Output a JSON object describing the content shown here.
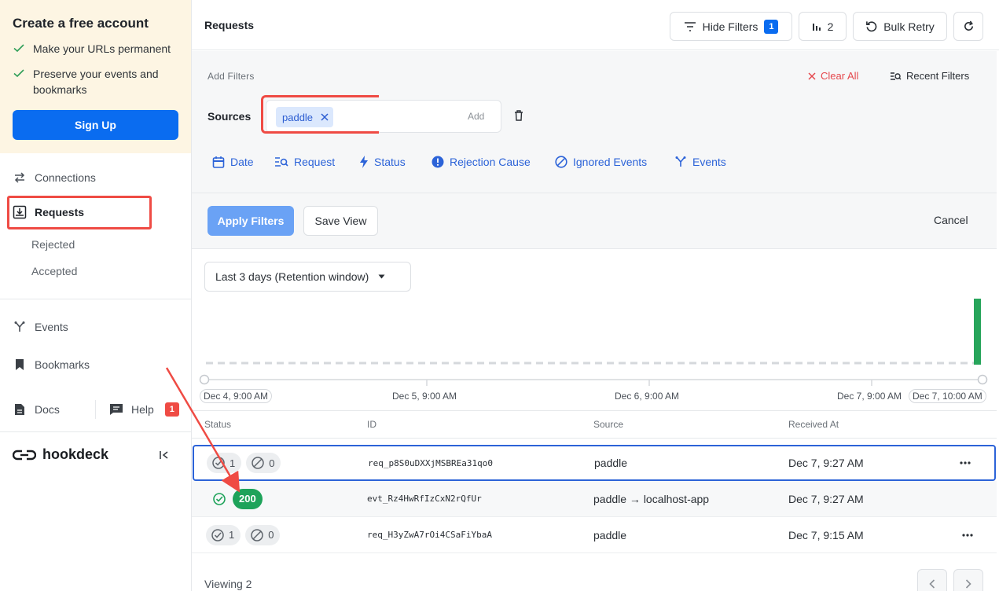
{
  "promo": {
    "title": "Create a free account",
    "bullets": [
      "Make your URLs permanent",
      "Preserve your events and bookmarks"
    ],
    "signup_label": "Sign Up"
  },
  "sidebar": {
    "connections": "Connections",
    "requests": "Requests",
    "rejected": "Rejected",
    "accepted": "Accepted",
    "events": "Events",
    "bookmarks": "Bookmarks",
    "docs": "Docs",
    "help": "Help",
    "help_count": "1",
    "brand": "hookdeck"
  },
  "header": {
    "title": "Requests",
    "hide_filters": "Hide Filters",
    "filter_count": "1",
    "chart_count": "2",
    "bulk_retry": "Bulk Retry"
  },
  "filters": {
    "add_filters": "Add Filters",
    "clear_all": "Clear All",
    "recent_filters": "Recent Filters",
    "sources_label": "Sources",
    "source_chip": "paddle",
    "add": "Add",
    "types": [
      "Date",
      "Request",
      "Status",
      "Rejection Cause",
      "Ignored Events",
      "Events"
    ],
    "apply": "Apply Filters",
    "save_view": "Save View",
    "cancel": "Cancel"
  },
  "chart": {
    "range": "Last 3 days (Retention window)",
    "ticks": [
      "Dec 4, 9:00 AM",
      "Dec 5, 9:00 AM",
      "Dec 6, 9:00 AM",
      "Dec 7, 9:00 AM",
      "Dec 7, 10:00 AM"
    ]
  },
  "chart_data": {
    "type": "bar",
    "x": [
      "Dec 4, 9:00 AM",
      "Dec 5, 9:00 AM",
      "Dec 6, 9:00 AM",
      "Dec 7, 9:00 AM",
      "Dec 7, 10:00 AM"
    ],
    "values": [
      0,
      0,
      0,
      2,
      0
    ],
    "bar_color": "#27a55b",
    "title": "",
    "xlabel": "",
    "ylabel": ""
  },
  "table": {
    "headers": [
      "Status",
      "ID",
      "Source",
      "Received At"
    ],
    "rows": [
      {
        "ok": "1",
        "blocked": "0",
        "id": "req_p8S0uDXXjMSBREa31qo0",
        "source": "paddle",
        "received": "Dec 7, 9:27 AM"
      },
      {
        "status_code": "200",
        "id": "evt_Rz4HwRfIzCxN2rQfUr",
        "source": "paddle → localhost-app",
        "received": "Dec 7, 9:27 AM"
      },
      {
        "ok": "1",
        "blocked": "0",
        "id": "req_H3yZwA7rOi4CSaFiYbaA",
        "source": "paddle",
        "received": "Dec 7, 9:15 AM"
      }
    ],
    "viewing": "Viewing 2"
  },
  "colors": {
    "accent": "#0a6cf0",
    "annotation_red": "#ef4b44",
    "success": "#1ea35a"
  }
}
